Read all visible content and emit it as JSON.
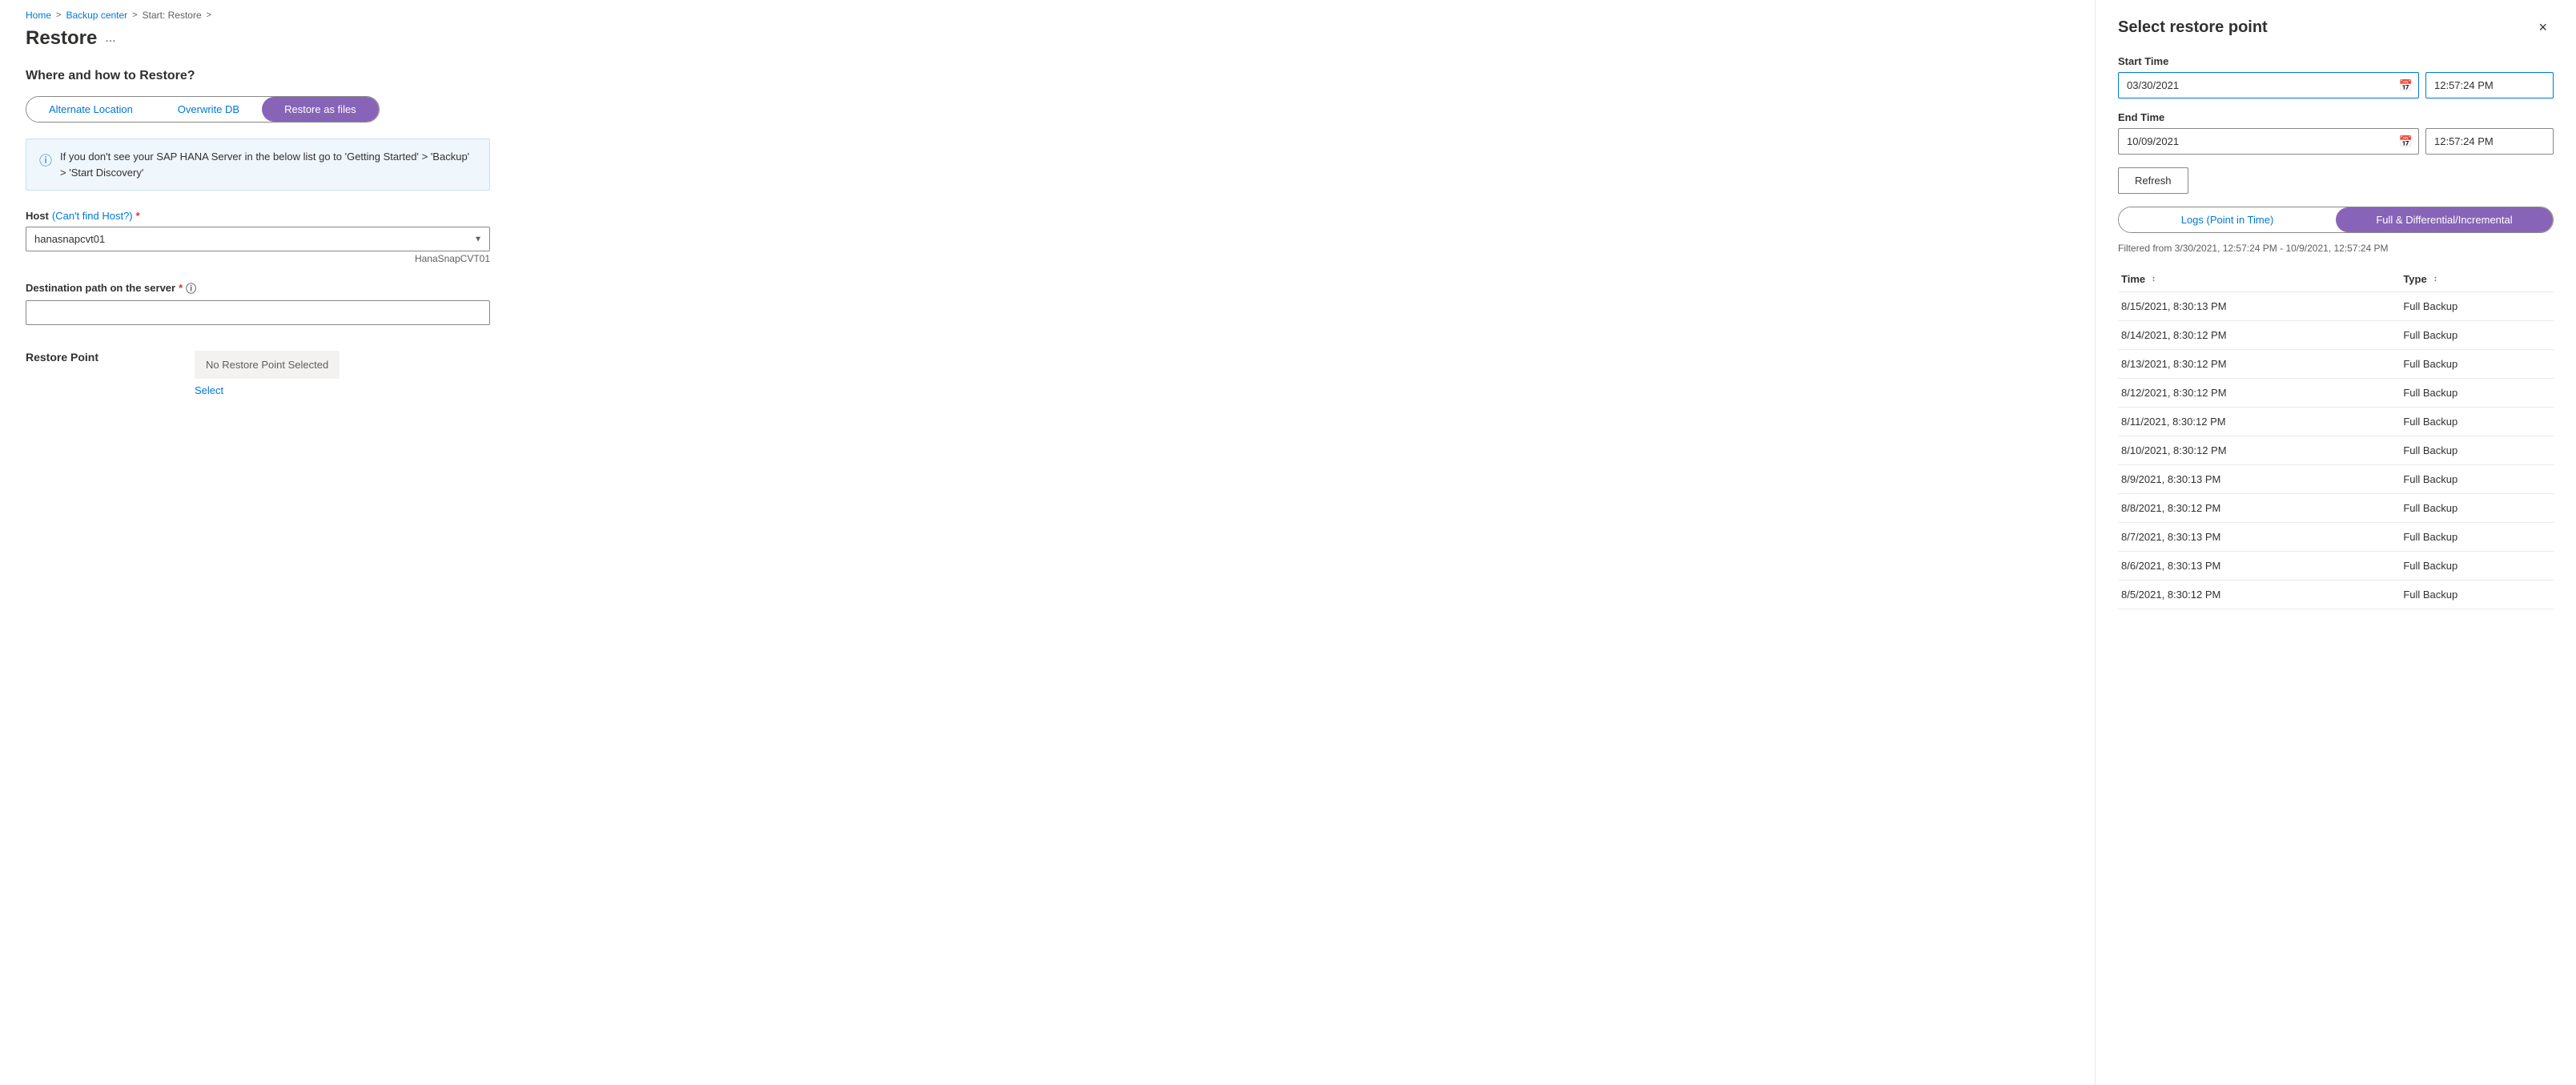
{
  "breadcrumb": {
    "home": "Home",
    "backup_center": "Backup center",
    "start_restore": "Start: Restore",
    "sep": ">"
  },
  "page": {
    "title": "Restore",
    "ellipsis": "...",
    "section_title": "Where and how to Restore?"
  },
  "tabs": {
    "alternate_location": "Alternate Location",
    "overwrite_db": "Overwrite DB",
    "restore_as_files": "Restore as files"
  },
  "info_box": {
    "text": "If you don't see your SAP HANA Server in the below list go to 'Getting Started' > 'Backup' > 'Start Discovery'"
  },
  "host_field": {
    "label": "Host",
    "link_text": "(Can't find Host?)",
    "value": "hanasnapcvt01",
    "hint": "HanaSnapCVT01"
  },
  "destination_field": {
    "label": "Destination path on the server",
    "value": "",
    "placeholder": ""
  },
  "restore_point": {
    "label": "Restore Point",
    "value": "No Restore Point Selected",
    "select_link": "Select"
  },
  "right_panel": {
    "title": "Select restore point",
    "close_label": "×",
    "start_time": {
      "label": "Start Time",
      "date": "03/30/2021",
      "time": "12:57:24 PM"
    },
    "end_time": {
      "label": "End Time",
      "date": "10/09/2021",
      "time": "12:57:24 PM"
    },
    "refresh_label": "Refresh",
    "toggle": {
      "logs": "Logs (Point in Time)",
      "full": "Full & Differential/Incremental"
    },
    "filter_text": "Filtered from 3/30/2021, 12:57:24 PM - 10/9/2021, 12:57:24 PM",
    "table": {
      "headers": [
        "Time",
        "Type"
      ],
      "rows": [
        {
          "time": "8/15/2021, 8:30:13 PM",
          "type": "Full Backup"
        },
        {
          "time": "8/14/2021, 8:30:12 PM",
          "type": "Full Backup"
        },
        {
          "time": "8/13/2021, 8:30:12 PM",
          "type": "Full Backup"
        },
        {
          "time": "8/12/2021, 8:30:12 PM",
          "type": "Full Backup"
        },
        {
          "time": "8/11/2021, 8:30:12 PM",
          "type": "Full Backup"
        },
        {
          "time": "8/10/2021, 8:30:12 PM",
          "type": "Full Backup"
        },
        {
          "time": "8/9/2021, 8:30:13 PM",
          "type": "Full Backup"
        },
        {
          "time": "8/8/2021, 8:30:12 PM",
          "type": "Full Backup"
        },
        {
          "time": "8/7/2021, 8:30:13 PM",
          "type": "Full Backup"
        },
        {
          "time": "8/6/2021, 8:30:13 PM",
          "type": "Full Backup"
        },
        {
          "time": "8/5/2021, 8:30:12 PM",
          "type": "Full Backup"
        }
      ]
    }
  }
}
